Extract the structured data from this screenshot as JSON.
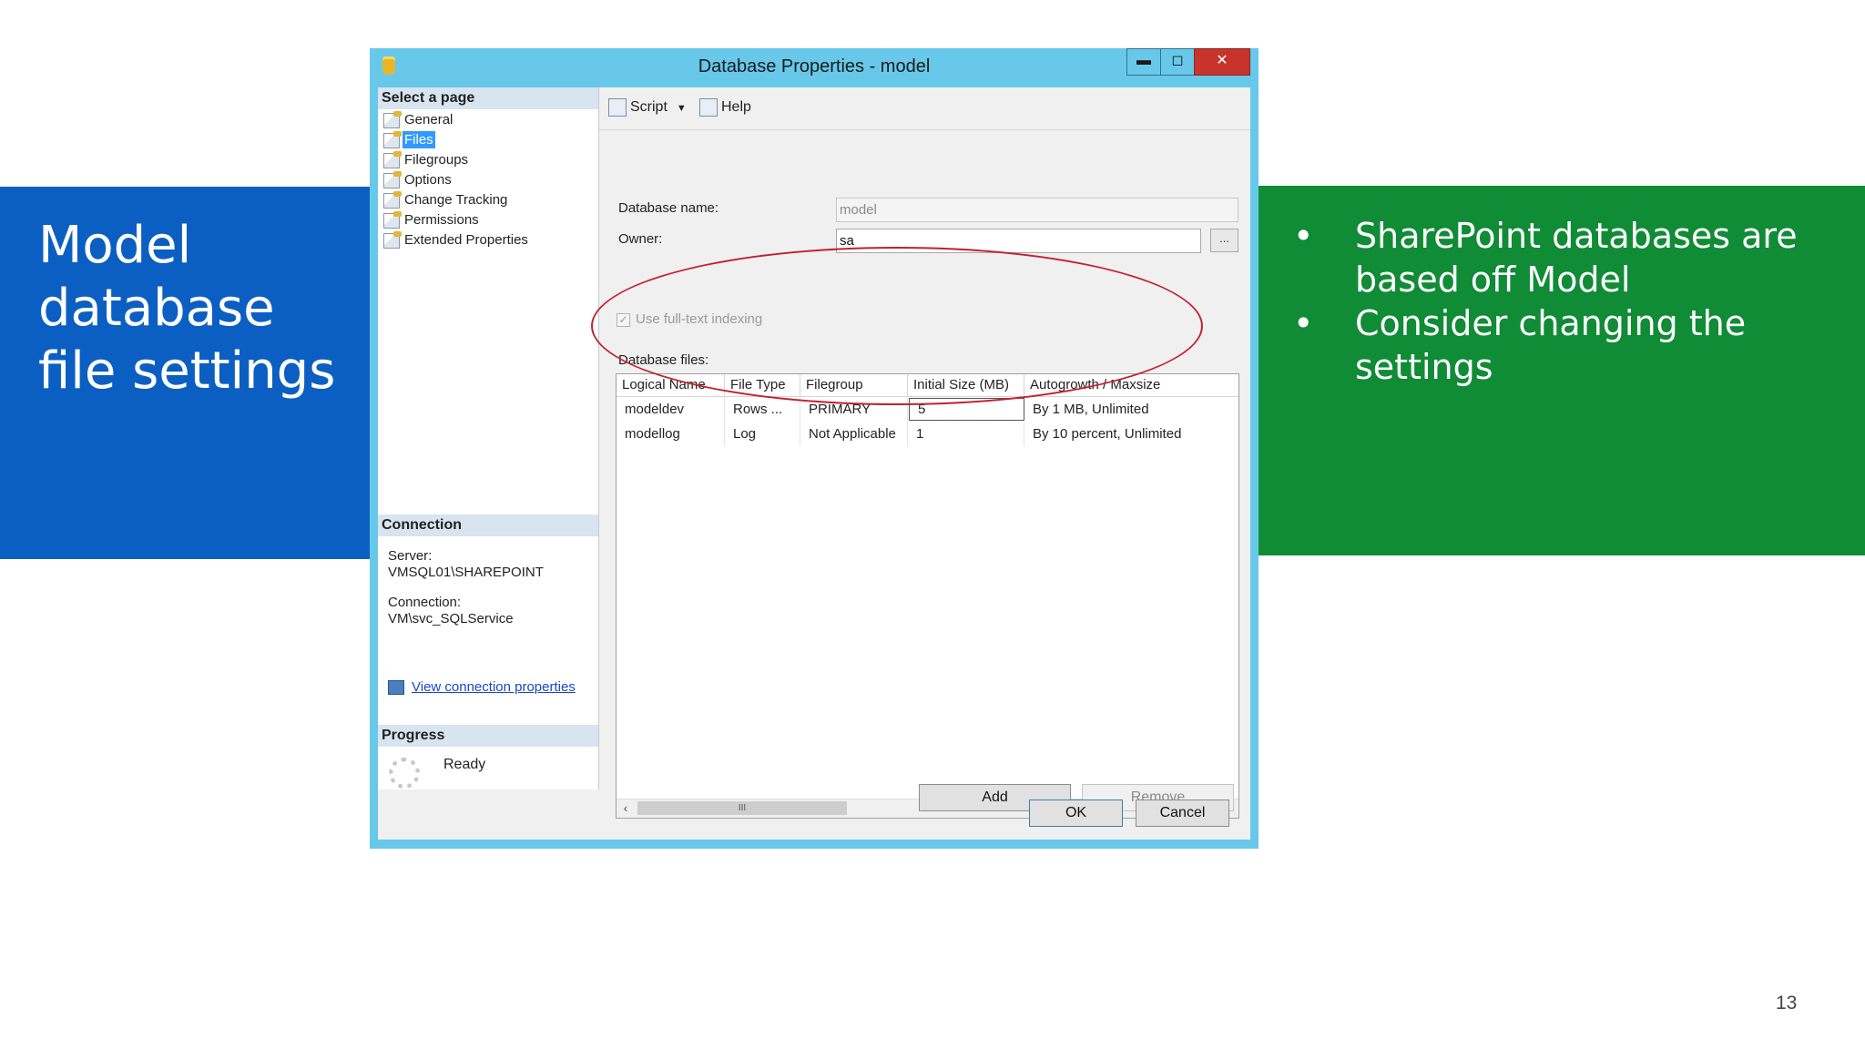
{
  "slide": {
    "title": "Model database file settings",
    "bullets": [
      "SharePoint databases are based off Model",
      "Consider changing the settings"
    ],
    "page_number": "13"
  },
  "window": {
    "title": "Database Properties - model",
    "controls": {
      "minimize": "▬",
      "maximize": "◻",
      "close": "✕"
    },
    "select_page_label": "Select a page",
    "pages": [
      {
        "label": "General",
        "icon": "page-icon"
      },
      {
        "label": "Files",
        "icon": "page-icon",
        "selected": true
      },
      {
        "label": "Filegroups",
        "icon": "page-icon"
      },
      {
        "label": "Options",
        "icon": "page-icon"
      },
      {
        "label": "Change Tracking",
        "icon": "page-icon"
      },
      {
        "label": "Permissions",
        "icon": "page-icon"
      },
      {
        "label": "Extended Properties",
        "icon": "page-icon"
      }
    ],
    "connection": {
      "header": "Connection",
      "server_label": "Server:",
      "server_value": "VMSQL01\\SHAREPOINT",
      "connection_label": "Connection:",
      "connection_value": "VM\\svc_SQLService",
      "link": "View connection properties"
    },
    "progress": {
      "header": "Progress",
      "status": "Ready"
    },
    "toolbar": {
      "script": "Script",
      "help": "Help"
    },
    "form": {
      "db_name_label": "Database name:",
      "db_name_value": "model",
      "owner_label": "Owner:",
      "owner_value": "sa",
      "browse_label": "...",
      "fulltext_label": "Use full-text indexing",
      "fulltext_checked": true,
      "files_label": "Database files:"
    },
    "files_table": {
      "columns": [
        "Logical Name",
        "File Type",
        "Filegroup",
        "Initial Size (MB)",
        "Autogrowth / Maxsize"
      ],
      "rows": [
        [
          "modeldev",
          "Rows ...",
          "PRIMARY",
          "5",
          "By 1 MB, Unlimited"
        ],
        [
          "modellog",
          "Log",
          "Not Applicable",
          "1",
          "By 10 percent, Unlimited"
        ]
      ],
      "scroll_thumb": "III"
    },
    "buttons": {
      "add": "Add",
      "remove": "Remove",
      "ok": "OK",
      "cancel": "Cancel"
    }
  },
  "colors": {
    "left_band": "#0b5fc2",
    "right_band": "#108b36",
    "window_frame": "#67c8ea",
    "highlight": "#c02131"
  }
}
